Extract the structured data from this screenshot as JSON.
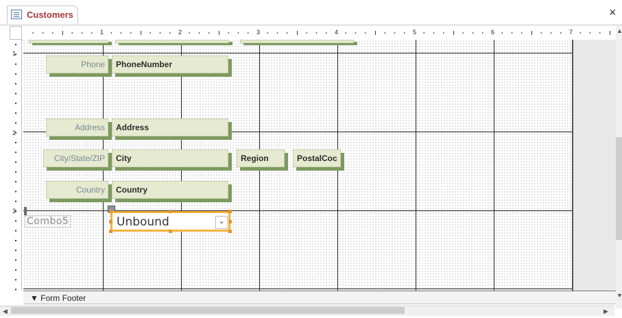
{
  "tab": {
    "title": "Customers",
    "icon": "form-icon"
  },
  "window": {
    "close_glyph": "×"
  },
  "ruler": {
    "horizontal_numbers": [
      "1",
      "2",
      "3",
      "4",
      "5",
      "6",
      "7"
    ],
    "vertical_numbers": [
      "1",
      "2",
      "3"
    ]
  },
  "controls": {
    "phone_label": "Phone",
    "phone_field": "PhoneNumber",
    "address_label": "Address",
    "address_field": "Address",
    "city_label": "City/State/ZIP",
    "city_field": "City",
    "region_field": "Region",
    "postal_field": "PostalCoc",
    "country_label": "Country",
    "country_field": "Country",
    "combo_label": "Combo5",
    "combo_value": "Unbound",
    "combo_arrow": "⌄"
  },
  "footer": {
    "label": "Form Footer",
    "icon": "section-expand-icon"
  },
  "colors": {
    "selection": "#f7b33c",
    "control_fill": "#e5ead0",
    "control_shadow": "#7e9a5f",
    "tab_title": "#a4373a"
  }
}
